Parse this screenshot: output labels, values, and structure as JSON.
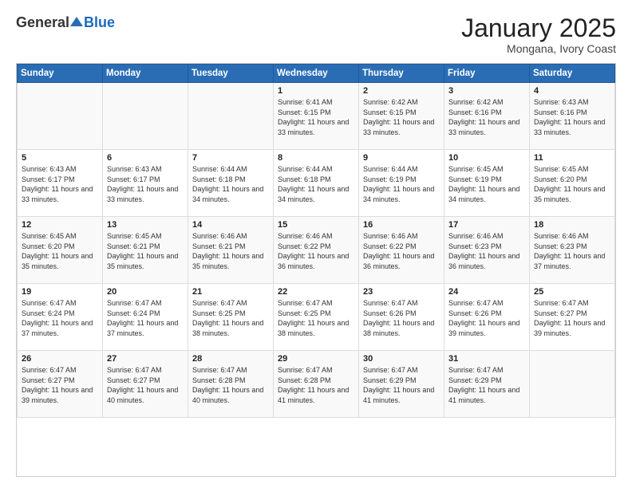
{
  "logo": {
    "general": "General",
    "blue": "Blue"
  },
  "title": "January 2025",
  "subtitle": "Mongana, Ivory Coast",
  "days_of_week": [
    "Sunday",
    "Monday",
    "Tuesday",
    "Wednesday",
    "Thursday",
    "Friday",
    "Saturday"
  ],
  "weeks": [
    [
      {
        "day": "",
        "info": ""
      },
      {
        "day": "",
        "info": ""
      },
      {
        "day": "",
        "info": ""
      },
      {
        "day": "1",
        "info": "Sunrise: 6:41 AM\nSunset: 6:15 PM\nDaylight: 11 hours and 33 minutes."
      },
      {
        "day": "2",
        "info": "Sunrise: 6:42 AM\nSunset: 6:15 PM\nDaylight: 11 hours and 33 minutes."
      },
      {
        "day": "3",
        "info": "Sunrise: 6:42 AM\nSunset: 6:16 PM\nDaylight: 11 hours and 33 minutes."
      },
      {
        "day": "4",
        "info": "Sunrise: 6:43 AM\nSunset: 6:16 PM\nDaylight: 11 hours and 33 minutes."
      }
    ],
    [
      {
        "day": "5",
        "info": "Sunrise: 6:43 AM\nSunset: 6:17 PM\nDaylight: 11 hours and 33 minutes."
      },
      {
        "day": "6",
        "info": "Sunrise: 6:43 AM\nSunset: 6:17 PM\nDaylight: 11 hours and 33 minutes."
      },
      {
        "day": "7",
        "info": "Sunrise: 6:44 AM\nSunset: 6:18 PM\nDaylight: 11 hours and 34 minutes."
      },
      {
        "day": "8",
        "info": "Sunrise: 6:44 AM\nSunset: 6:18 PM\nDaylight: 11 hours and 34 minutes."
      },
      {
        "day": "9",
        "info": "Sunrise: 6:44 AM\nSunset: 6:19 PM\nDaylight: 11 hours and 34 minutes."
      },
      {
        "day": "10",
        "info": "Sunrise: 6:45 AM\nSunset: 6:19 PM\nDaylight: 11 hours and 34 minutes."
      },
      {
        "day": "11",
        "info": "Sunrise: 6:45 AM\nSunset: 6:20 PM\nDaylight: 11 hours and 35 minutes."
      }
    ],
    [
      {
        "day": "12",
        "info": "Sunrise: 6:45 AM\nSunset: 6:20 PM\nDaylight: 11 hours and 35 minutes."
      },
      {
        "day": "13",
        "info": "Sunrise: 6:45 AM\nSunset: 6:21 PM\nDaylight: 11 hours and 35 minutes."
      },
      {
        "day": "14",
        "info": "Sunrise: 6:46 AM\nSunset: 6:21 PM\nDaylight: 11 hours and 35 minutes."
      },
      {
        "day": "15",
        "info": "Sunrise: 6:46 AM\nSunset: 6:22 PM\nDaylight: 11 hours and 36 minutes."
      },
      {
        "day": "16",
        "info": "Sunrise: 6:46 AM\nSunset: 6:22 PM\nDaylight: 11 hours and 36 minutes."
      },
      {
        "day": "17",
        "info": "Sunrise: 6:46 AM\nSunset: 6:23 PM\nDaylight: 11 hours and 36 minutes."
      },
      {
        "day": "18",
        "info": "Sunrise: 6:46 AM\nSunset: 6:23 PM\nDaylight: 11 hours and 37 minutes."
      }
    ],
    [
      {
        "day": "19",
        "info": "Sunrise: 6:47 AM\nSunset: 6:24 PM\nDaylight: 11 hours and 37 minutes."
      },
      {
        "day": "20",
        "info": "Sunrise: 6:47 AM\nSunset: 6:24 PM\nDaylight: 11 hours and 37 minutes."
      },
      {
        "day": "21",
        "info": "Sunrise: 6:47 AM\nSunset: 6:25 PM\nDaylight: 11 hours and 38 minutes."
      },
      {
        "day": "22",
        "info": "Sunrise: 6:47 AM\nSunset: 6:25 PM\nDaylight: 11 hours and 38 minutes."
      },
      {
        "day": "23",
        "info": "Sunrise: 6:47 AM\nSunset: 6:26 PM\nDaylight: 11 hours and 38 minutes."
      },
      {
        "day": "24",
        "info": "Sunrise: 6:47 AM\nSunset: 6:26 PM\nDaylight: 11 hours and 39 minutes."
      },
      {
        "day": "25",
        "info": "Sunrise: 6:47 AM\nSunset: 6:27 PM\nDaylight: 11 hours and 39 minutes."
      }
    ],
    [
      {
        "day": "26",
        "info": "Sunrise: 6:47 AM\nSunset: 6:27 PM\nDaylight: 11 hours and 39 minutes."
      },
      {
        "day": "27",
        "info": "Sunrise: 6:47 AM\nSunset: 6:27 PM\nDaylight: 11 hours and 40 minutes."
      },
      {
        "day": "28",
        "info": "Sunrise: 6:47 AM\nSunset: 6:28 PM\nDaylight: 11 hours and 40 minutes."
      },
      {
        "day": "29",
        "info": "Sunrise: 6:47 AM\nSunset: 6:28 PM\nDaylight: 11 hours and 41 minutes."
      },
      {
        "day": "30",
        "info": "Sunrise: 6:47 AM\nSunset: 6:29 PM\nDaylight: 11 hours and 41 minutes."
      },
      {
        "day": "31",
        "info": "Sunrise: 6:47 AM\nSunset: 6:29 PM\nDaylight: 11 hours and 41 minutes."
      },
      {
        "day": "",
        "info": ""
      }
    ]
  ]
}
